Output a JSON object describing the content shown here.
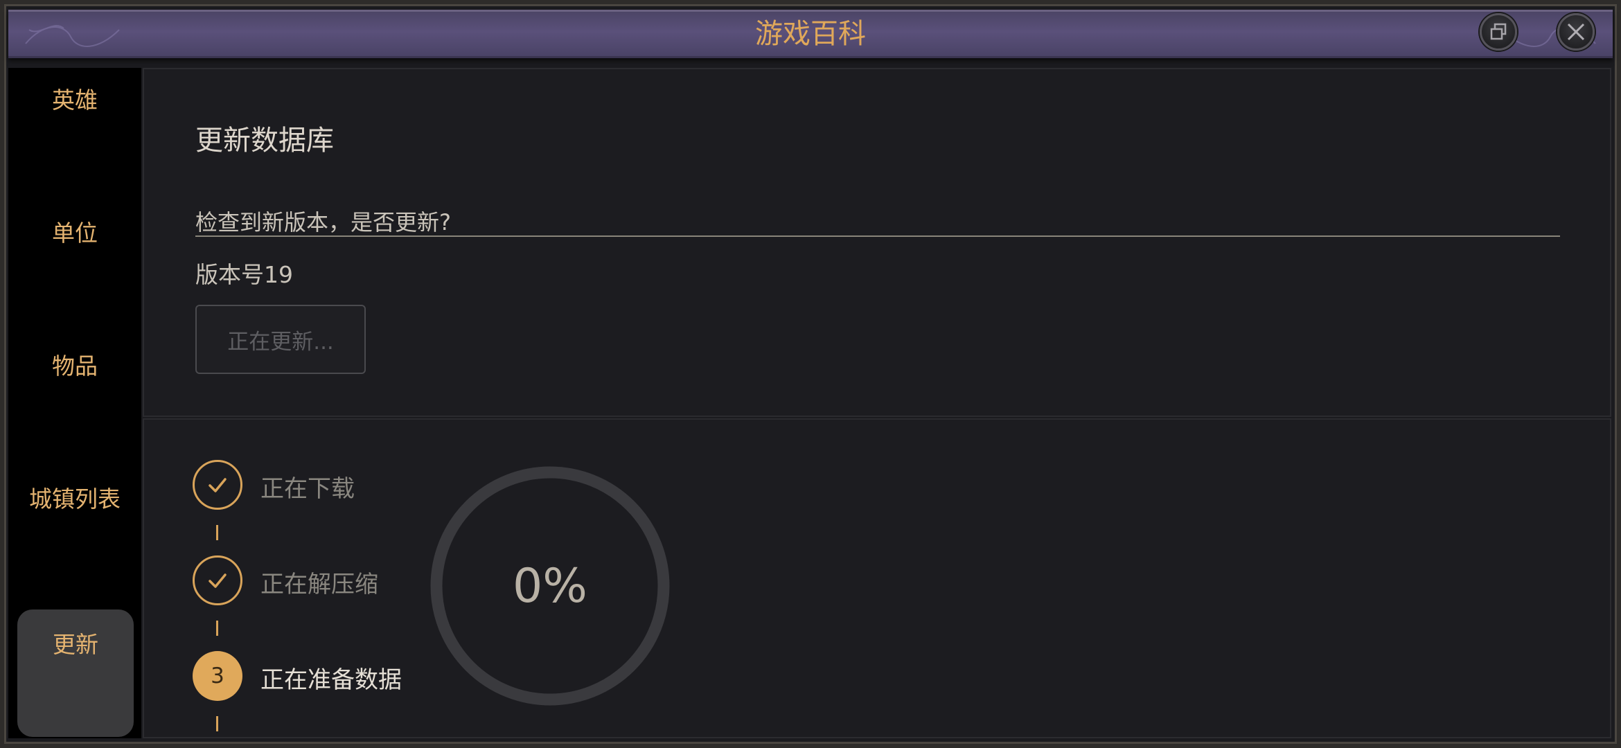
{
  "window": {
    "title": "游戏百科"
  },
  "sidebar": {
    "items": [
      {
        "label": "英雄"
      },
      {
        "label": "单位"
      },
      {
        "label": "物品"
      },
      {
        "label": "城镇列表"
      },
      {
        "label": "更新",
        "active": true
      }
    ]
  },
  "update": {
    "heading": "更新数据库",
    "prompt": "检查到新版本，是否更新?",
    "version": "版本号19",
    "button_label": "正在更新..."
  },
  "progress": {
    "steps": [
      {
        "label": "正在下载",
        "state": "done"
      },
      {
        "label": "正在解压缩",
        "state": "done"
      },
      {
        "label": "正在准备数据",
        "state": "current",
        "number": "3"
      }
    ],
    "percent_text": "0%",
    "percent_value": 0
  },
  "colors": {
    "accent": "#e0a95b",
    "panel": "#1c1c20",
    "titlebar": "#5a507a"
  }
}
